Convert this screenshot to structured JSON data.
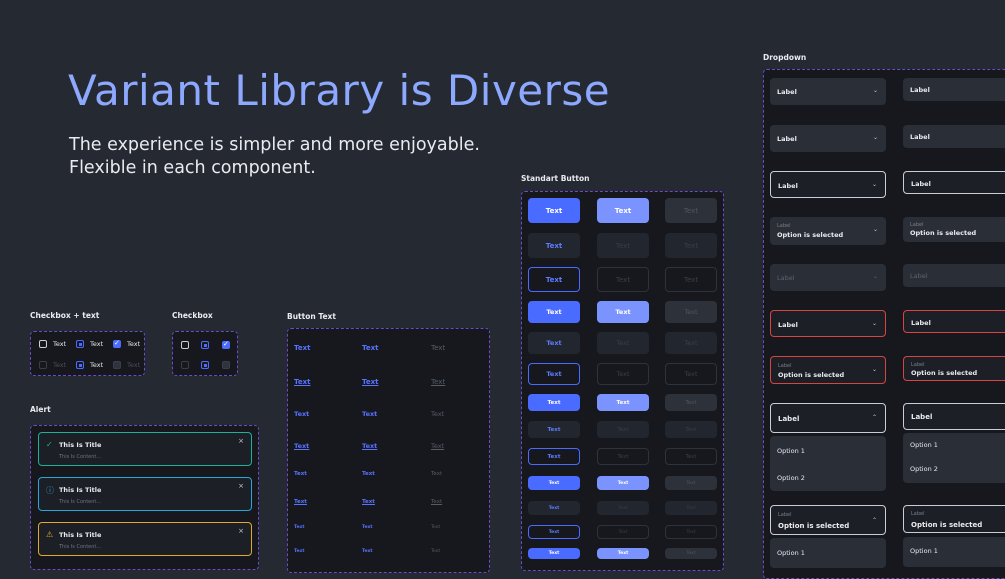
{
  "hero": {
    "title": "Variant Library is Diverse",
    "subtitle_line1": "The experience is simpler and more enjoyable.",
    "subtitle_line2": "Flexible in each component."
  },
  "sections": {
    "checkbox_text": "Checkbox + text",
    "checkbox": "Checkbox",
    "alert": "Alert",
    "button_text": "Button Text",
    "standart_button": "Standart Button",
    "dropdown": "Dropdown"
  },
  "checkbox_text": {
    "label": "Text"
  },
  "alerts": [
    {
      "title": "This Is Title",
      "content": "This Is Content...",
      "type": "success",
      "color": "#19b39a"
    },
    {
      "title": "This Is Title",
      "content": "This Is Content...",
      "type": "info",
      "color": "#2aa7d8"
    },
    {
      "title": "This Is Title",
      "content": "This Is Content...",
      "type": "warning",
      "color": "#e0a82e"
    }
  ],
  "alert_close": "×",
  "button_text": {
    "label": "Text"
  },
  "standart_button": {
    "label": "Text"
  },
  "dropdown": {
    "label": "Label",
    "selected": "Option is selected",
    "option1": "Option 1",
    "option2": "Option 2"
  },
  "colors": {
    "background": "#252932",
    "accent": "#4a6bff",
    "title": "#8da8ff",
    "dashed_border": "#6a4cc4",
    "error": "#d6453f"
  }
}
